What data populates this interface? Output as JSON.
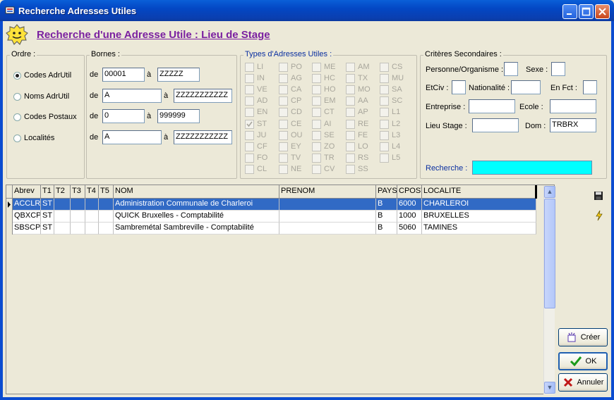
{
  "window": {
    "title": "Recherche Adresses Utiles"
  },
  "header": {
    "title": "Recherche d'une Adresse Utile : Lieu de Stage"
  },
  "ordre": {
    "legend": "Ordre :",
    "options": [
      {
        "label": "Codes AdrUtil",
        "selected": true
      },
      {
        "label": "Noms AdrUtil",
        "selected": false
      },
      {
        "label": "Codes Postaux",
        "selected": false
      },
      {
        "label": "Localités",
        "selected": false
      }
    ]
  },
  "bornes": {
    "legend": "Bornes :",
    "de_label": "de",
    "a_label": "à",
    "rows": [
      {
        "from": "00001",
        "to": "ZZZZZ"
      },
      {
        "from": "A",
        "to": "ZZZZZZZZZZZ"
      },
      {
        "from": "0",
        "to": "999999"
      },
      {
        "from": "A",
        "to": "ZZZZZZZZZZZ"
      }
    ]
  },
  "types": {
    "legend": "Types d'Adresses Utiles :",
    "columns": [
      [
        "LI",
        "IN",
        "VE",
        "AD",
        "EN",
        "ST",
        "JU",
        "CF",
        "FO",
        "CL"
      ],
      [
        "PO",
        "AG",
        "CA",
        "CP",
        "CD",
        "CE",
        "OU",
        "EY",
        "TV",
        "NE"
      ],
      [
        "ME",
        "HC",
        "HO",
        "EM",
        "CT",
        "AI",
        "SE",
        "ZO",
        "TR",
        "CV"
      ],
      [
        "AM",
        "TX",
        "MO",
        "AA",
        "AP",
        "RE",
        "FE",
        "LO",
        "RS",
        "SS"
      ],
      [
        "CS",
        "MU",
        "SA",
        "SC",
        "L1",
        "L2",
        "L3",
        "L4",
        "L5"
      ]
    ],
    "checked": [
      "ST"
    ]
  },
  "criteres": {
    "legend": "Critères Secondaires :",
    "personne_label": "Personne/Organisme :",
    "personne_value": "",
    "sexe_label": "Sexe :",
    "sexe_value": "",
    "etciv_label": "EtCiv :",
    "etciv_value": "",
    "nationalite_label": "Nationalité :",
    "nationalite_value": "",
    "enfct_label": "En Fct :",
    "enfct_value": "",
    "entreprise_label": "Entreprise :",
    "entreprise_value": "",
    "ecole_label": "Ecole :",
    "ecole_value": "",
    "lieustage_label": "Lieu Stage :",
    "lieustage_value": "",
    "dom_label": "Dom :",
    "dom_value": "TRBRX",
    "recherche_label": "Recherche :",
    "recherche_value": ""
  },
  "grid": {
    "columns": [
      "Abrev",
      "T1",
      "T2",
      "T3",
      "T4",
      "T5",
      "NOM",
      "PRENOM",
      "PAYS",
      "CPOST",
      "LOCALITE"
    ],
    "rows": [
      [
        "ACCLR",
        "ST",
        "",
        "",
        "",
        "",
        "Administration Communale de Charleroi",
        "",
        "B",
        "6000",
        "CHARLEROI"
      ],
      [
        "QBXCP",
        "ST",
        "",
        "",
        "",
        "",
        "QUICK Bruxelles - Comptabilité",
        "",
        "B",
        "1000",
        "BRUXELLES"
      ],
      [
        "SBSCP",
        "ST",
        "",
        "",
        "",
        "",
        "Sambremétal Sambreville - Comptabilité",
        "",
        "B",
        "5060",
        "TAMINES"
      ]
    ],
    "selected_row": 0
  },
  "buttons": {
    "creer": "Créer",
    "ok": "OK",
    "annuler": "Annuler"
  },
  "icons": {
    "save": "floppy-disk-icon",
    "lightning": "lightning-icon"
  }
}
